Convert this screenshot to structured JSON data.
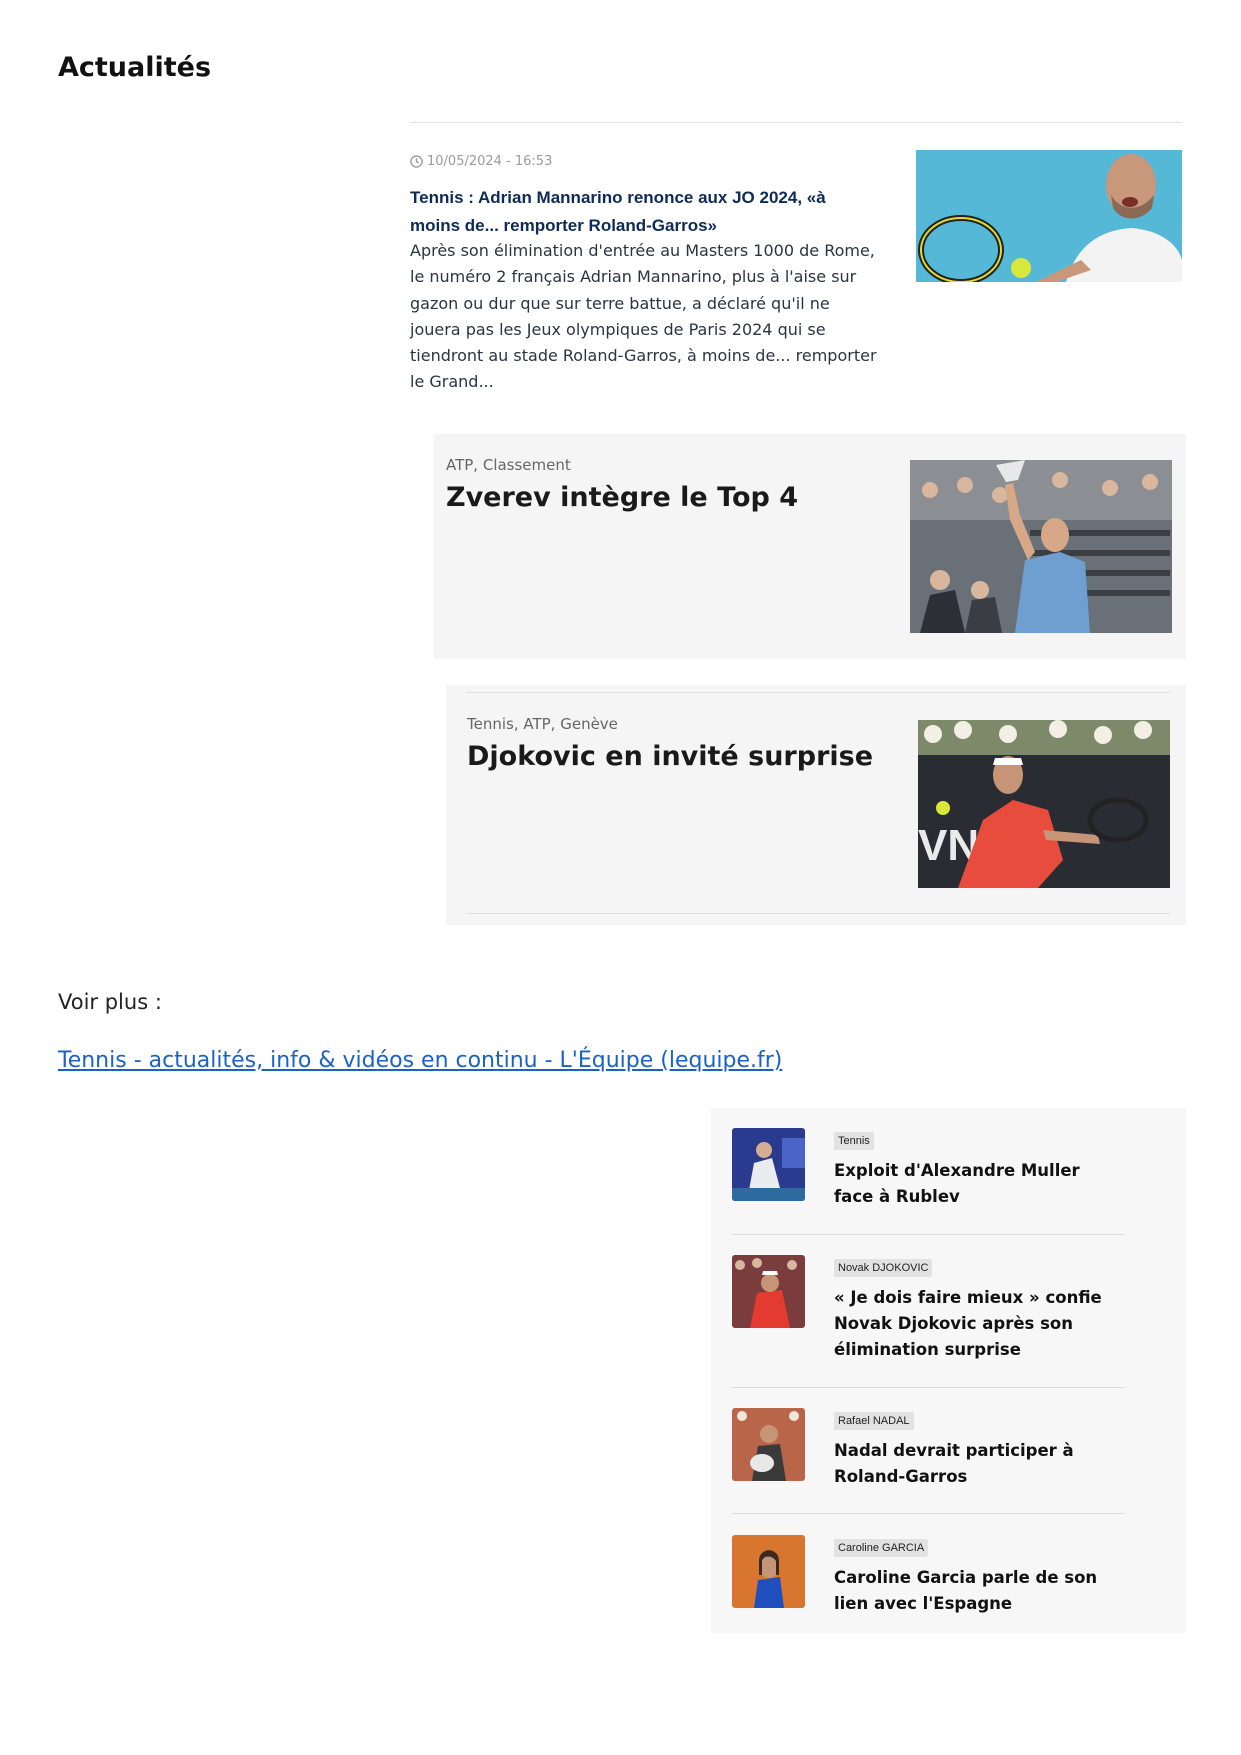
{
  "page": {
    "title": "Actualités"
  },
  "articles": [
    {
      "meta": "10/05/2024 - 16:53",
      "title": "Tennis : Adrian Mannarino renonce aux JO 2024, «à moins de... remporter Roland-Garros»",
      "excerpt": "Après son élimination d'entrée au Masters 1000 de Rome, le numéro 2 français Adrian Mannarino, plus à l'aise sur gazon ou dur que sur terre battue, a déclaré qu'il ne jouera pas les Jeux olympiques de Paris 2024 qui se tiendront au stade Roland-Garros, à moins de... remporter le Grand..."
    },
    {
      "category": "ATP, Classement",
      "title": "Zverev intègre le Top 4"
    },
    {
      "category": "Tennis, ATP, Genève",
      "title": "Djokovic en invité surprise"
    }
  ],
  "more": {
    "label": "Voir plus :",
    "link_text": "Tennis - actualités, info & vidéos en continu - L'Équipe (lequipe.fr)"
  },
  "related": [
    {
      "tag": "Tennis",
      "title": "Exploit d'Alexandre Muller face à Rublev"
    },
    {
      "tag": "Novak DJOKOVIC",
      "title": "« Je dois faire mieux » confie Novak Djokovic après son élimination surprise"
    },
    {
      "tag": "Rafael NADAL",
      "title": "Nadal devrait participer à Roland-Garros"
    },
    {
      "tag": "Caroline GARCIA",
      "title": "Caroline Garcia parle de son lien avec l'Espagne"
    }
  ]
}
